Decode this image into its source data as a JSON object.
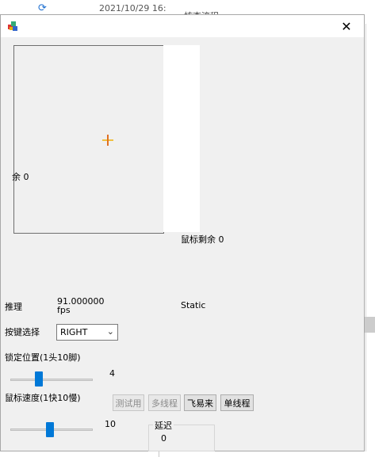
{
  "background": {
    "timestamp": "2021/10/29 16:",
    "side_text": "核查流程"
  },
  "window": {
    "close_symbol": "✕"
  },
  "preview": {
    "clipped_label": "余 0"
  },
  "labels": {
    "mouse_remaining": "鼠标剩余 0",
    "inference": "推理",
    "fps_value": "91.000000",
    "fps_unit": "fps",
    "status": "Static",
    "key_select": "按键选择",
    "lock_position": "锁定位置(1头10脚)",
    "mouse_speed": "鼠标速度(1快10慢)",
    "delay_group": "延迟"
  },
  "key_select": {
    "selected": "RIGHT"
  },
  "lock_slider": {
    "value_text": "4",
    "value": 4,
    "min": 1,
    "max": 10
  },
  "speed_slider": {
    "value_text": "10",
    "value": 10,
    "min": 1,
    "max": 10
  },
  "buttons": {
    "test": "测试用",
    "multithread": "多线程",
    "feiyilai": "飞易来",
    "single_thread": "单线程"
  },
  "delay": {
    "value": "0"
  },
  "colors": {
    "accent": "#0078d7",
    "window_bg": "#f0f0f0"
  }
}
